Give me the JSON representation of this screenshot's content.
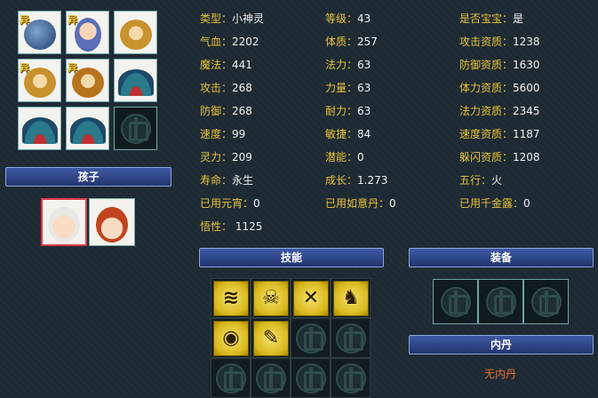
{
  "pet_slots": [
    {
      "icon": "ox-demon-pet-icon",
      "badge": "异",
      "kind": "ox"
    },
    {
      "icon": "fairy-maiden-pet-icon",
      "badge": "异",
      "kind": "fairy"
    },
    {
      "icon": "monkey-pet-icon",
      "badge": "",
      "kind": "monkey"
    },
    {
      "icon": "monkey-pet-icon",
      "badge": "异",
      "kind": "monkey"
    },
    {
      "icon": "monkey-pet-icon",
      "badge": "异",
      "kind": "monkey2"
    },
    {
      "icon": "fan-pet-icon",
      "badge": "",
      "kind": "fan"
    },
    {
      "icon": "fan-pet-icon",
      "badge": "",
      "kind": "fan"
    },
    {
      "icon": "fan-pet-icon",
      "badge": "",
      "kind": "fan"
    },
    {
      "icon": "empty-slot-knot-icon",
      "badge": "",
      "kind": "empty"
    }
  ],
  "children_header": "孩子",
  "children": [
    {
      "icon": "boy-child-icon",
      "selected": true
    },
    {
      "icon": "girl-child-icon",
      "selected": false
    }
  ],
  "stats": [
    {
      "label": "类型：",
      "value": "小神灵"
    },
    {
      "label": "等级：",
      "value": "43"
    },
    {
      "label": "是否宝宝：",
      "value": "是"
    },
    {
      "label": "气血：",
      "value": "2202"
    },
    {
      "label": "体质：",
      "value": "257"
    },
    {
      "label": "攻击资质：",
      "value": "1238"
    },
    {
      "label": "魔法：",
      "value": "441"
    },
    {
      "label": "法力：",
      "value": "63"
    },
    {
      "label": "防御资质：",
      "value": "1630"
    },
    {
      "label": "攻击：",
      "value": "268"
    },
    {
      "label": "力量：",
      "value": "63"
    },
    {
      "label": "体力资质：",
      "value": "5600"
    },
    {
      "label": "防御：",
      "value": "268"
    },
    {
      "label": "耐力：",
      "value": "63"
    },
    {
      "label": "法力资质：",
      "value": "2345"
    },
    {
      "label": "速度：",
      "value": "99"
    },
    {
      "label": "敏捷：",
      "value": "84"
    },
    {
      "label": "速度资质：",
      "value": "1187"
    },
    {
      "label": "灵力：",
      "value": "209"
    },
    {
      "label": "潜能：",
      "value": "0"
    },
    {
      "label": "躲闪资质：",
      "value": "1208"
    },
    {
      "label": "寿命：",
      "value": "永生"
    },
    {
      "label": "成长：",
      "value": "1.273"
    },
    {
      "label": "五行：",
      "value": "火"
    },
    {
      "label": "已用元宵：",
      "value": "0"
    },
    {
      "label": "已用如意丹：",
      "value": "0"
    },
    {
      "label": "已用千金露：",
      "value": "0"
    },
    {
      "label": "悟性：",
      "value": " 1125"
    }
  ],
  "skills_header": "技能",
  "skills": [
    {
      "icon": "claw-skill-icon",
      "glyph": "≋"
    },
    {
      "icon": "skeleton-skill-icon",
      "glyph": "☠"
    },
    {
      "icon": "blades-skill-icon",
      "glyph": "✕"
    },
    {
      "icon": "meditation-skill-icon",
      "glyph": "♞"
    },
    {
      "icon": "eye-skill-icon",
      "glyph": "◉"
    },
    {
      "icon": "scroll-skill-icon",
      "glyph": "✎"
    }
  ],
  "equipment_header": "装备",
  "neidan_header": "内丹",
  "neidan_empty": "无内丹",
  "colors": {
    "label": "#e6c23a",
    "value": "#f1f1f1",
    "header": "#2d4487",
    "empty_text": "#e0722e"
  }
}
